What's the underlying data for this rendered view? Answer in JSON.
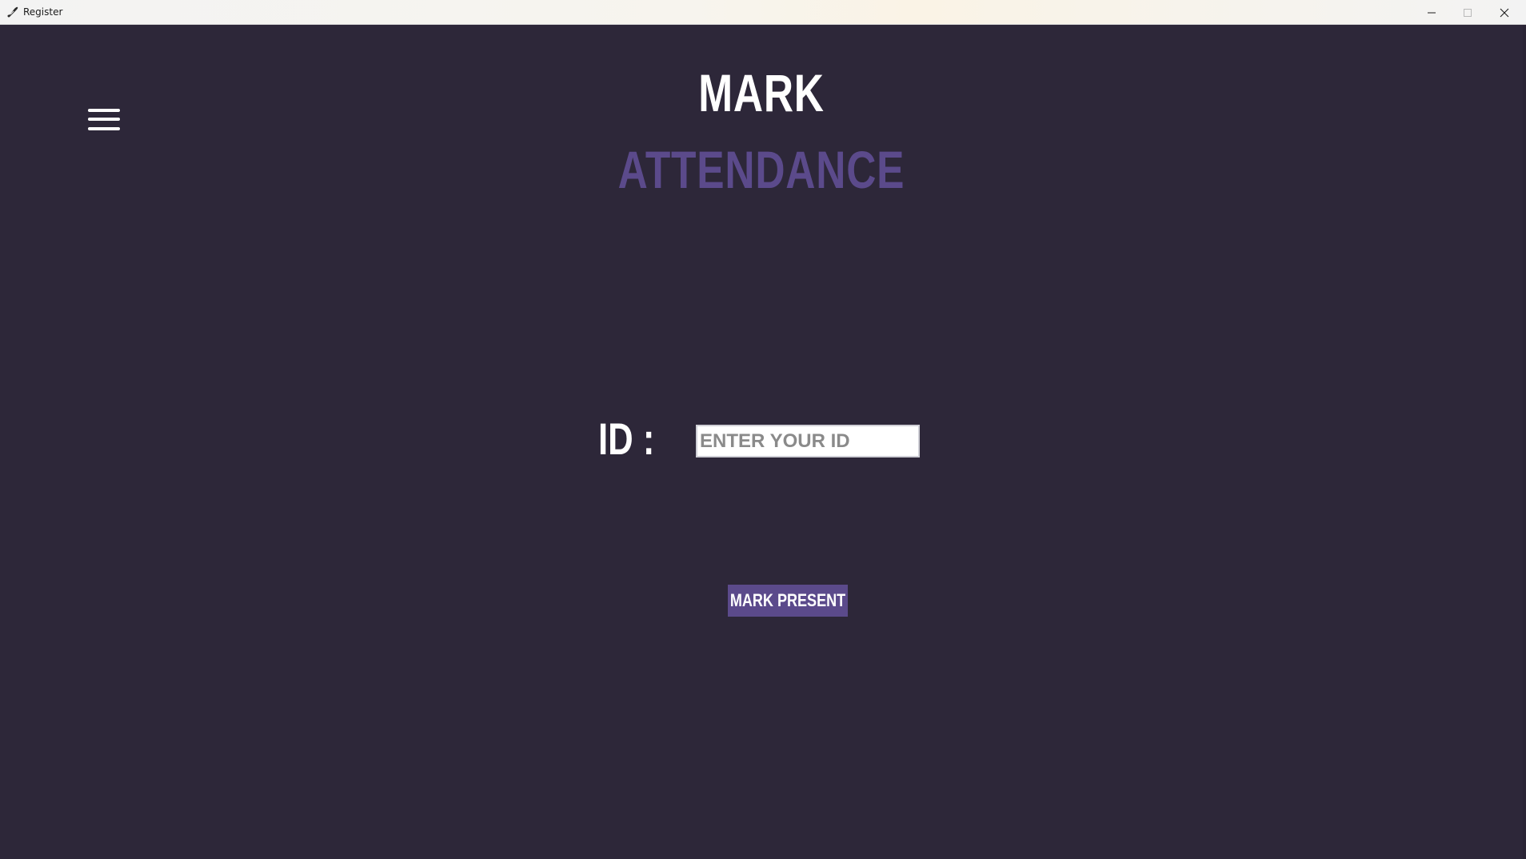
{
  "window": {
    "title": "Register",
    "icon": "feather-pen-icon",
    "controls": [
      "minimize-icon",
      "maximize-icon",
      "close-icon"
    ]
  },
  "menu": {
    "icon": "hamburger-menu-icon"
  },
  "heading": {
    "line1": "MARK",
    "line2": "ATTENDANCE"
  },
  "form": {
    "id_label": "ID :",
    "id_placeholder": "ENTER YOUR ID",
    "id_value": ""
  },
  "actions": {
    "mark_present_label": "MARK PRESENT"
  },
  "colors": {
    "background": "#2d2739",
    "accent": "#5b4a8b",
    "text": "#ffffff"
  }
}
